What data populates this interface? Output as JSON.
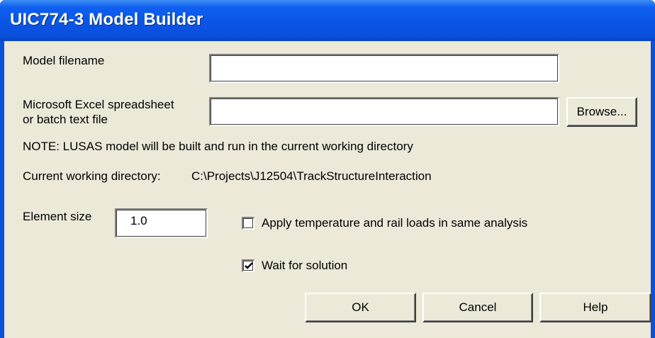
{
  "window": {
    "title": "UIC774-3 Model Builder"
  },
  "form": {
    "model_filename_label": "Model filename",
    "model_filename_value": "",
    "spreadsheet_label_line1": "Microsoft Excel spreadsheet",
    "spreadsheet_label_line2": "or batch text file",
    "spreadsheet_value": "",
    "browse_label": "Browse...",
    "note": "NOTE: LUSAS model will be built and run in the current working directory",
    "cwd_label": "Current working directory:",
    "cwd_value": "C:\\Projects\\J12504\\TrackStructureInteraction",
    "element_size_label": "Element size",
    "element_size_value": "1.0",
    "apply_temp_label": "Apply temperature and rail loads in same analysis",
    "apply_temp_checked": false,
    "wait_label": "Wait for solution",
    "wait_checked": true
  },
  "buttons": {
    "ok": "OK",
    "cancel": "Cancel",
    "help": "Help"
  }
}
